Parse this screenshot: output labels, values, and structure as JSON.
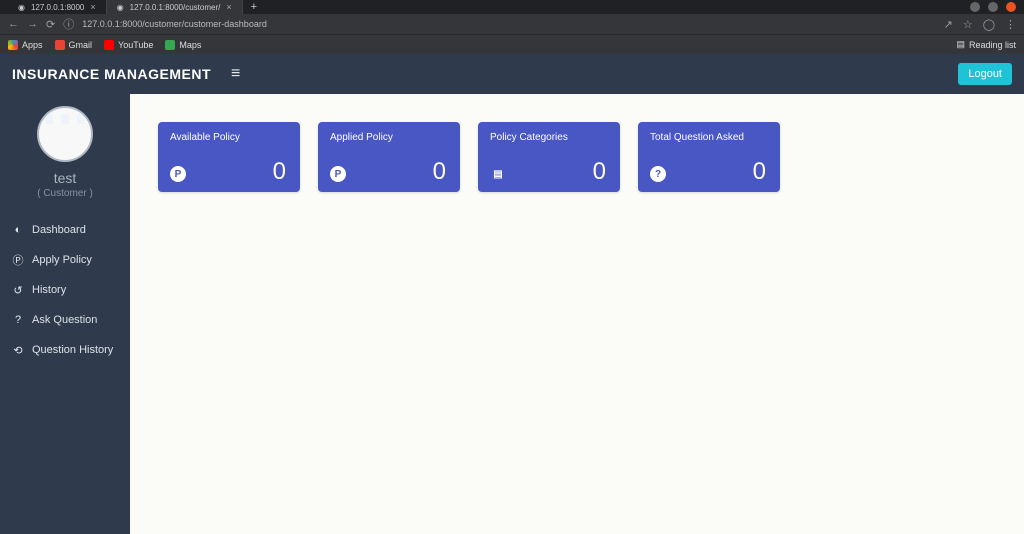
{
  "browser": {
    "tabs": [
      {
        "title": "127.0.0.1:8000"
      },
      {
        "title": "127.0.0.1:8000/customer/"
      }
    ],
    "url": "127.0.0.1:8000/customer/customer-dashboard",
    "bookmarks": {
      "apps": "Apps",
      "gmail": "Gmail",
      "youtube": "YouTube",
      "maps": "Maps",
      "reading_list": "Reading list"
    }
  },
  "app": {
    "brand": "INSURANCE MANAGEMENT",
    "logout": "Logout",
    "user": {
      "name": "test",
      "role": "( Customer )"
    },
    "menu": [
      {
        "label": "Dashboard",
        "icon": "dashboard"
      },
      {
        "label": "Apply Policy",
        "icon": "policy"
      },
      {
        "label": "History",
        "icon": "history"
      },
      {
        "label": "Ask Question",
        "icon": "question"
      },
      {
        "label": "Question History",
        "icon": "refresh"
      }
    ],
    "cards": [
      {
        "title": "Available Policy",
        "value": "0",
        "icon": "P"
      },
      {
        "title": "Applied Policy",
        "value": "0",
        "icon": "P"
      },
      {
        "title": "Policy Categories",
        "value": "0",
        "icon": "list"
      },
      {
        "title": "Total Question Asked",
        "value": "0",
        "icon": "?"
      }
    ]
  }
}
